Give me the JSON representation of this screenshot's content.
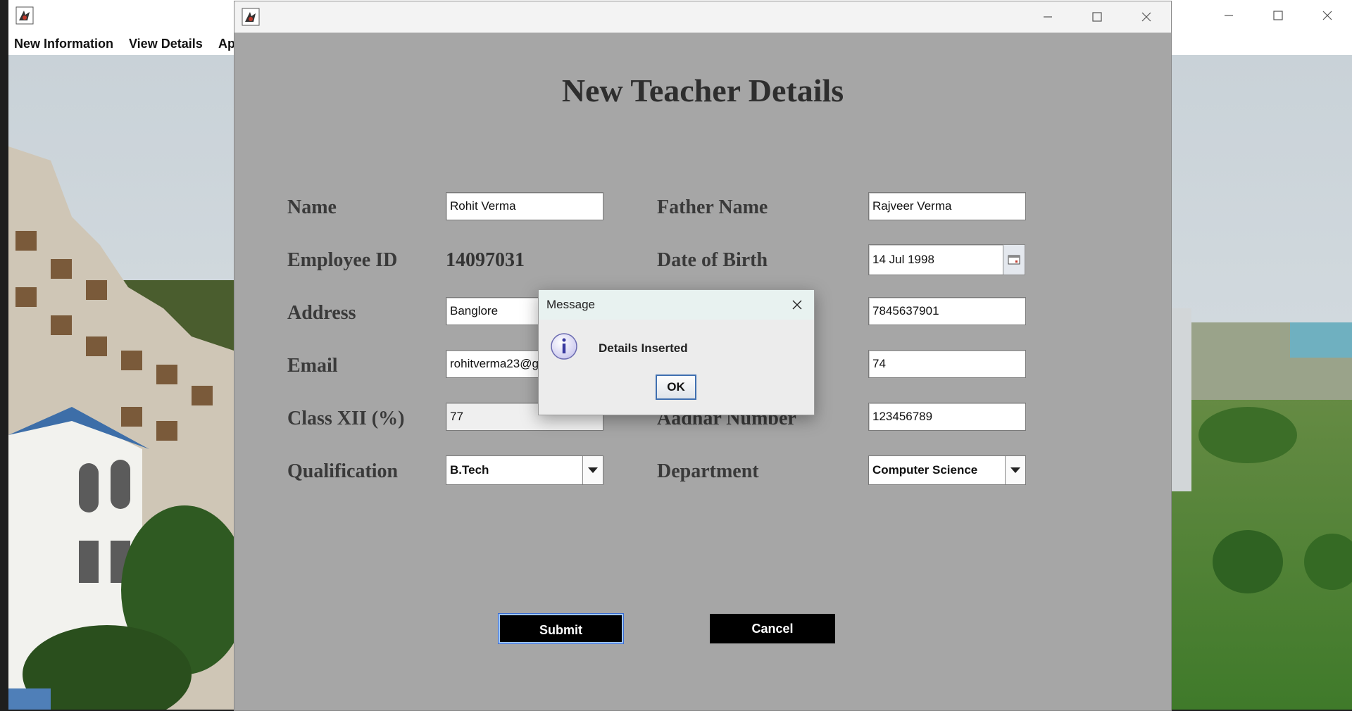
{
  "main_window": {
    "menu": [
      "New Information",
      "View Details",
      "Ap"
    ]
  },
  "dialog": {
    "title": "New Teacher Details",
    "labels": {
      "name": "Name",
      "father_name": "Father Name",
      "employee_id": "Employee ID",
      "date_of_birth": "Date of Birth",
      "address": "Address",
      "email": "Email",
      "class_xii": "Class XII (%)",
      "aadhar": "Aadhar Number",
      "qualification": "Qualification",
      "department": "Department"
    },
    "values": {
      "name": "Rohit Verma",
      "father_name": "Rajveer Verma",
      "employee_id": "14097031",
      "date_of_birth": "14 Jul 1998",
      "address": "Banglore",
      "phone": "7845637901",
      "email": "rohitverma23@g",
      "class_x": "74",
      "class_xii": "77",
      "aadhar": "123456789",
      "qualification": "B.Tech",
      "department": "Computer Science"
    },
    "buttons": {
      "submit": "Submit",
      "cancel": "Cancel"
    }
  },
  "message_dialog": {
    "title": "Message",
    "text": "Details Inserted",
    "ok": "OK",
    "icon": "info-icon"
  },
  "colors": {
    "dialog_bg": "#a6a6a6",
    "button_bg": "#000000",
    "message_titlebar": "#e8f2f0"
  }
}
